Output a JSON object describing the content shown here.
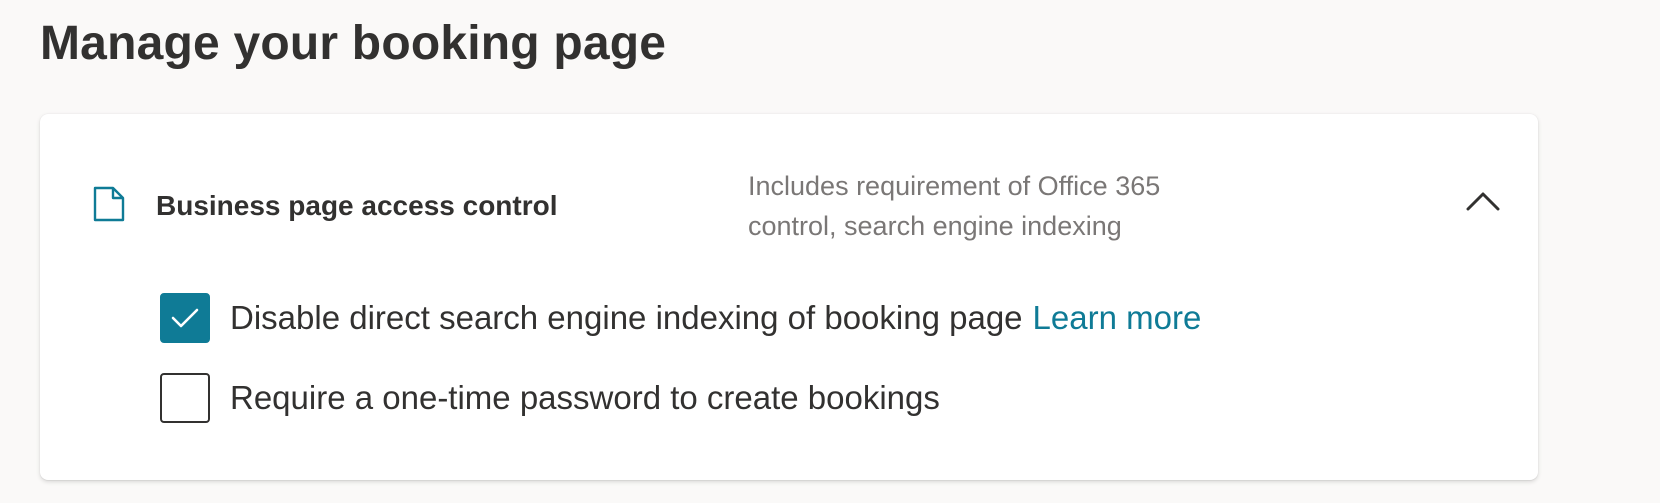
{
  "page": {
    "title": "Manage your booking page"
  },
  "access_control": {
    "icon": "document-icon",
    "title": "Business page access control",
    "description": "Includes requirement of Office 365 control, search engine indexing",
    "expanded": true,
    "options": [
      {
        "label": "Disable direct search engine indexing of booking page",
        "checked": true,
        "link_label": "Learn more"
      },
      {
        "label": "Require a one-time password to create bookings",
        "checked": false
      }
    ]
  },
  "colors": {
    "accent": "#0f7b96",
    "text": "#323130",
    "muted_text": "#7a7776",
    "background": "#faf9f8",
    "card": "#ffffff"
  }
}
